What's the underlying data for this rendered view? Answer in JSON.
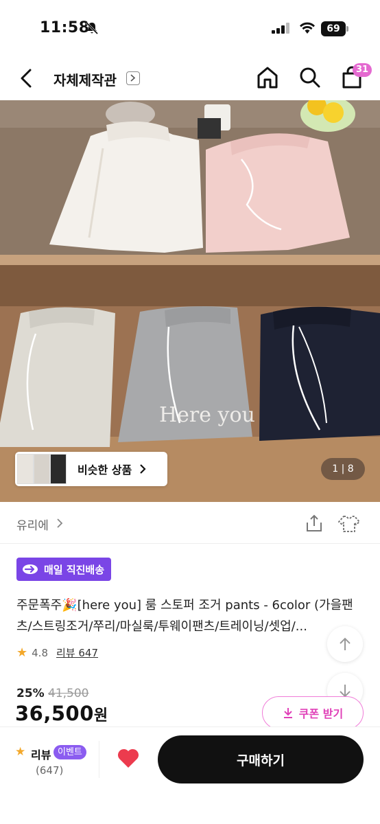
{
  "status_bar": {
    "time": "11:58",
    "battery": "69"
  },
  "header": {
    "title": "자체제작관",
    "cart_count": "31"
  },
  "hero": {
    "similar_label": "비슷한 상품",
    "pager": "1 | 8",
    "image_caption_text": "Here you"
  },
  "brand": {
    "name": "유리에"
  },
  "delivery_badge": "매일 직진배송",
  "product": {
    "title": "주문폭주🎉[here you] 룸 스토퍼 조거 pants - 6color (가을팬츠/스트링조거/쭈리/마실룩/투웨이팬츠/트레이닝/셋업/...",
    "rating": "4.8",
    "review_label": "리뷰 647",
    "discount": "25%",
    "original_price": "41,500",
    "price": "36,500",
    "currency": "원",
    "coupon_label": "쿠폰 받기"
  },
  "bottom_bar": {
    "review_label": "리뷰",
    "event_label": "이벤트",
    "review_count": "(647)",
    "buy_label": "구매하기"
  },
  "colors": {
    "accent_pink": "#e040b8",
    "badge_purple": "#7a45e6",
    "event_purple": "#8b5cf0",
    "heart_red": "#ec3b4e",
    "star": "#f3a82b"
  }
}
